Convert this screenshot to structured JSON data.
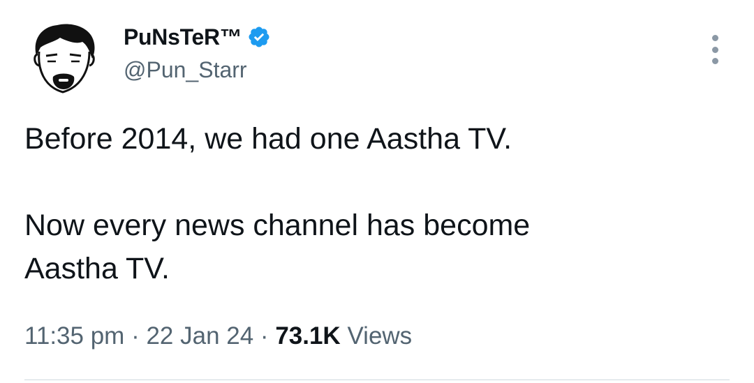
{
  "author": {
    "display_name": "PuNsTeR™",
    "handle": "@Pun_Starr",
    "verified": true,
    "avatar_icon": "man-with-goatee-icon"
  },
  "tweet": {
    "lines": [
      "Before 2014, we had one Aastha TV.",
      "Now every news channel has become",
      "Aastha TV."
    ]
  },
  "meta": {
    "time": "11:35 pm",
    "separator": " · ",
    "date": "22 Jan 24",
    "views_count": "73.1K",
    "views_label": "Views"
  },
  "colors": {
    "text": "#0f1419",
    "secondary": "#536471",
    "verified": "#1d9bf0",
    "divider": "#cfd9de"
  }
}
